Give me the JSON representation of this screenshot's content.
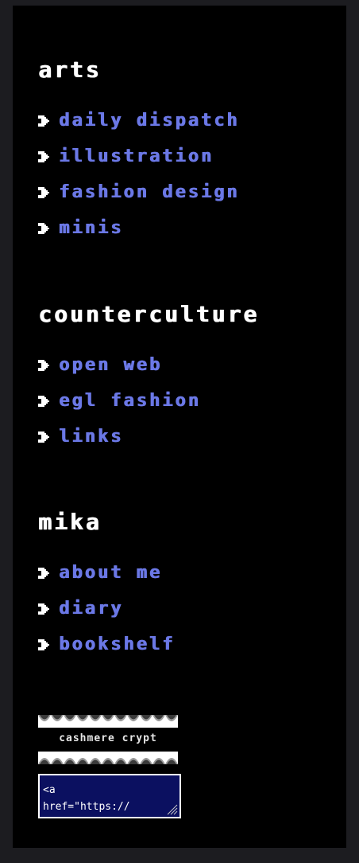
{
  "sections": [
    {
      "title": "arts",
      "items": [
        {
          "label": "daily dispatch"
        },
        {
          "label": "illustration"
        },
        {
          "label": "fashion design"
        },
        {
          "label": "minis"
        }
      ]
    },
    {
      "title": "counterculture",
      "items": [
        {
          "label": "open web"
        },
        {
          "label": "egl fashion"
        },
        {
          "label": "links"
        }
      ]
    },
    {
      "title": "mika",
      "items": [
        {
          "label": "about me"
        },
        {
          "label": "diary"
        },
        {
          "label": "bookshelf"
        }
      ]
    }
  ],
  "badge": {
    "text": "cashmere crypt"
  },
  "code_snippet": {
    "line1": "<a",
    "line2": "href=\"https://"
  },
  "icons": {
    "bullet": "arrow-bullet-icon",
    "grip": "resize-grip-icon"
  },
  "colors": {
    "link": "#6b78e6",
    "heading": "#ffffff",
    "panel": "#000000",
    "page": "#1c1c20",
    "code_box": "#0b1060"
  }
}
